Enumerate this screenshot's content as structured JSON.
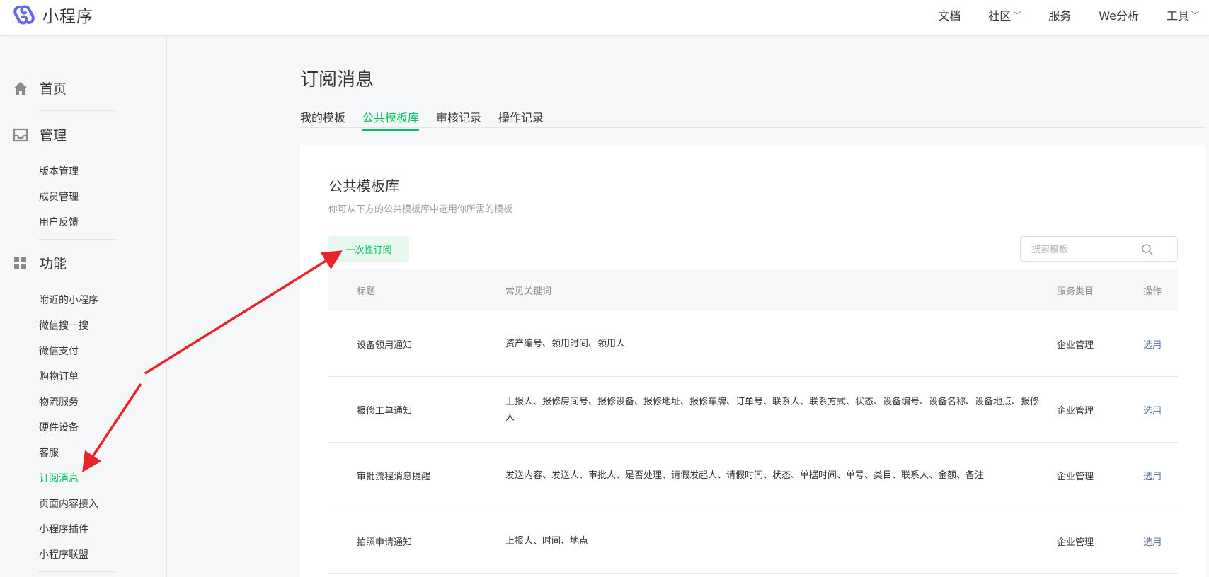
{
  "header": {
    "brand": "小程序",
    "nav": [
      {
        "label": "文档"
      },
      {
        "label": "社区"
      },
      {
        "label": "服务"
      },
      {
        "label": "We分析"
      },
      {
        "label": "工具"
      }
    ]
  },
  "sidebar": {
    "home": "首页",
    "manage": {
      "label": "管理",
      "items": [
        "版本管理",
        "成员管理",
        "用户反馈"
      ]
    },
    "features": {
      "label": "功能",
      "items": [
        "附近的小程序",
        "微信搜一搜",
        "微信支付",
        "购物订单",
        "物流服务",
        "硬件设备",
        "客服",
        "订阅消息",
        "页面内容接入",
        "小程序插件",
        "小程序联盟"
      ],
      "active": "订阅消息"
    }
  },
  "main": {
    "title": "订阅消息",
    "tabs": [
      "我的模板",
      "公共模板库",
      "审核记录",
      "操作记录"
    ],
    "active_tab": "公共模板库",
    "card": {
      "title": "公共模板库",
      "description": "你可从下方的公共模板库中选用你所需的模板",
      "filter": "一次性订阅",
      "search_placeholder": "搜索模板",
      "columns": [
        "标题",
        "常见关键词",
        "服务类目",
        "操作"
      ],
      "rows": [
        {
          "title": "设备领用通知",
          "keywords": "资产编号、领用时间、领用人",
          "category": "企业管理",
          "action": "选用"
        },
        {
          "title": "报修工单通知",
          "keywords": "上报人、报修房间号、报修设备、报修地址、报修车牌、订单号、联系人、联系方式、状态、设备编号、设备名称、设备地点、报修人",
          "category": "企业管理",
          "action": "选用"
        },
        {
          "title": "审批流程消息提醒",
          "keywords": "发送内容、发送人、审批人、是否处理、请假发起人、请假时间、状态、单据时间、单号、类目、联系人、金额、备注",
          "category": "企业管理",
          "action": "选用"
        },
        {
          "title": "拍照申请通知",
          "keywords": "上报人、时间、地点",
          "category": "企业管理",
          "action": "选用"
        }
      ]
    }
  },
  "colors": {
    "accent": "#07c160",
    "link": "#576b95",
    "annotation_arrow": "#e8242a"
  }
}
